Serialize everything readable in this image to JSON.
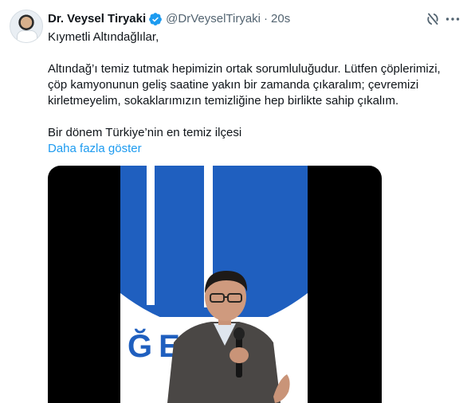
{
  "author": {
    "name": "Dr. Veysel Tiryaki",
    "handle": "@DrVeyselTiryaki",
    "separator": "·",
    "time": "20s"
  },
  "tweet": {
    "greeting": "Kıymetli Altındağlılar,",
    "body": "Altındağ’ı temiz tutmak hepimizin ortak sorumluluğudur. Lütfen çöplerimizi, çöp kamyonunun geliş saatine yakın bir zamanda çıkaralım; çevremizi kirletmeyelim, sokaklarımızın temizliğine hep birlikte sahip çıkalım.",
    "tagline": "Bir dönem Türkiye’nin en temiz ilçesi",
    "show_more": "Daha fazla göster"
  },
  "media": {
    "backdrop_letters": "ĞEL"
  },
  "icons": {
    "verified": "verified-badge-icon",
    "grok": "grok-icon",
    "more": "more-options-icon"
  },
  "colors": {
    "accent": "#1d9bf0",
    "text": "#0f1419",
    "muted": "#536471",
    "backdrop_blue": "#1f5fbf"
  }
}
